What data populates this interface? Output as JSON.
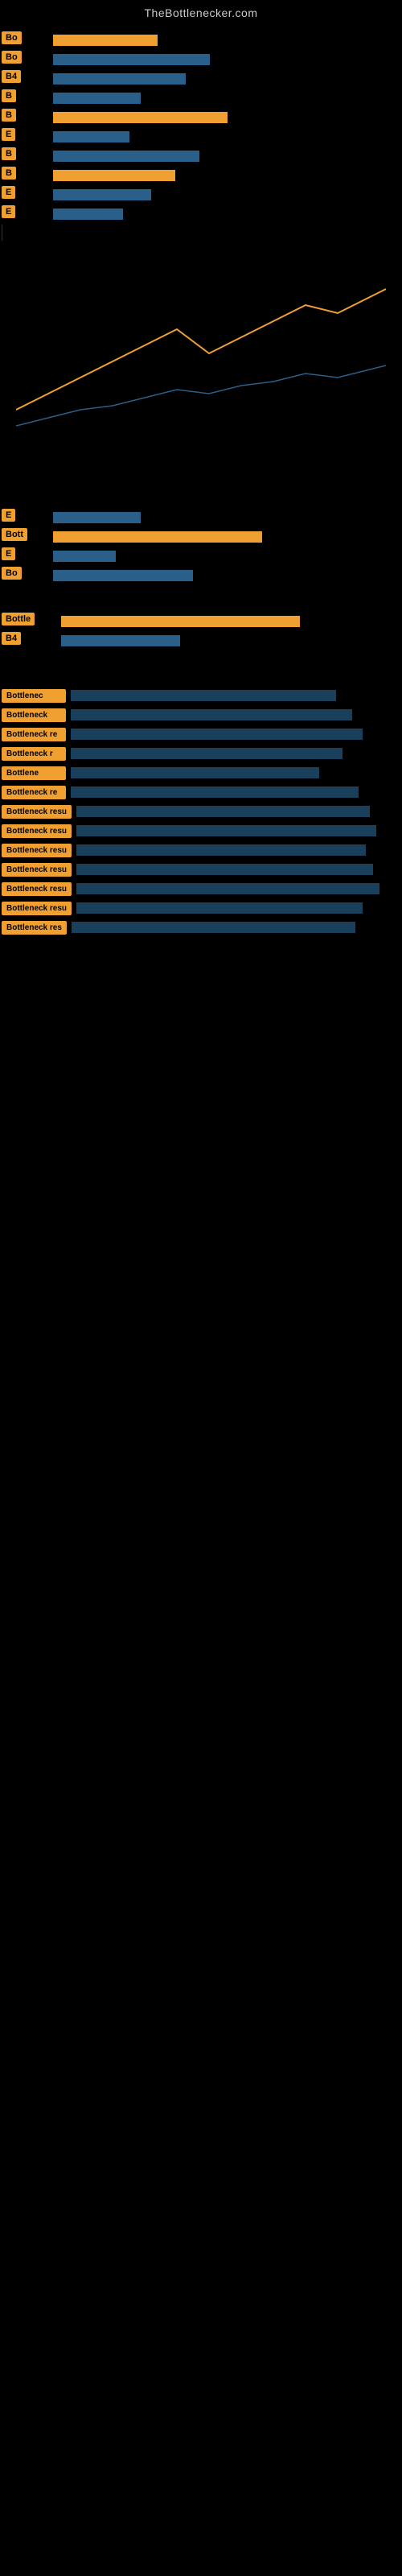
{
  "site": {
    "title": "TheBottlenecker.com"
  },
  "top_rows": [
    {
      "badge": "Bo",
      "bar_width": "30%",
      "bar_type": "orange"
    },
    {
      "badge": "Bo",
      "bar_width": "45%",
      "bar_type": "blue"
    },
    {
      "badge": "B4",
      "bar_width": "38%",
      "bar_type": "blue"
    },
    {
      "badge": "B",
      "bar_width": "25%",
      "bar_type": "blue"
    },
    {
      "badge": "B",
      "bar_width": "50%",
      "bar_type": "orange"
    },
    {
      "badge": "E",
      "bar_width": "22%",
      "bar_type": "blue"
    },
    {
      "badge": "B",
      "bar_width": "42%",
      "bar_type": "blue"
    },
    {
      "badge": "B",
      "bar_width": "35%",
      "bar_type": "orange"
    },
    {
      "badge": "E",
      "bar_width": "28%",
      "bar_type": "blue"
    },
    {
      "badge": "E",
      "bar_width": "20%",
      "bar_type": "blue"
    }
  ],
  "mid_rows": [
    {
      "badge": "E",
      "bar_width": "25%",
      "bar_type": "blue"
    },
    {
      "badge": "Bott",
      "bar_width": "60%",
      "bar_type": "orange"
    },
    {
      "badge": "E",
      "bar_width": "18%",
      "bar_type": "blue"
    },
    {
      "badge": "Bo",
      "bar_width": "40%",
      "bar_type": "blue"
    }
  ],
  "lower_rows": [
    {
      "badge": "Bottle",
      "bar_width": "70%",
      "bar_type": "orange"
    },
    {
      "badge": "B4",
      "bar_width": "35%",
      "bar_type": "blue"
    }
  ],
  "bottom_rows": [
    {
      "badge": "Bottlenec",
      "bar_width": "80%"
    },
    {
      "badge": "Bottleneck",
      "bar_width": "85%"
    },
    {
      "badge": "Bottleneck re",
      "bar_width": "88%"
    },
    {
      "badge": "Bottleneck r",
      "bar_width": "82%"
    },
    {
      "badge": "Bottlene",
      "bar_width": "75%"
    },
    {
      "badge": "Bottleneck re",
      "bar_width": "87%"
    },
    {
      "badge": "Bottleneck resu",
      "bar_width": "90%"
    },
    {
      "badge": "Bottleneck resu",
      "bar_width": "92%"
    },
    {
      "badge": "Bottleneck resu",
      "bar_width": "89%"
    },
    {
      "badge": "Bottleneck resu",
      "bar_width": "91%"
    },
    {
      "badge": "Bottleneck resu",
      "bar_width": "93%"
    },
    {
      "badge": "Bottleneck resu",
      "bar_width": "88%"
    },
    {
      "badge": "Bottleneck res",
      "bar_width": "86%"
    }
  ]
}
